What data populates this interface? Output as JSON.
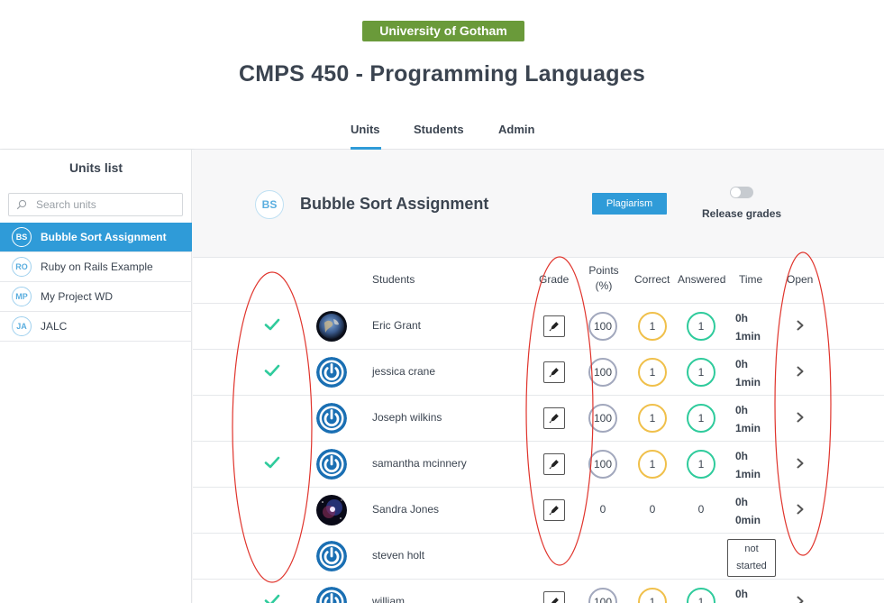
{
  "header": {
    "university": "University of Gotham",
    "course_title": "CMPS 450 - Programming Languages",
    "tabs": [
      {
        "label": "Units",
        "active": true
      },
      {
        "label": "Students",
        "active": false
      },
      {
        "label": "Admin",
        "active": false
      }
    ]
  },
  "sidebar": {
    "title": "Units list",
    "search_placeholder": "Search units",
    "units": [
      {
        "initials": "BS",
        "label": "Bubble Sort Assignment",
        "active": true
      },
      {
        "initials": "RO",
        "label": "Ruby on Rails Example",
        "active": false
      },
      {
        "initials": "MP",
        "label": "My Project WD",
        "active": false
      },
      {
        "initials": "JA",
        "label": "JALC",
        "active": false
      }
    ]
  },
  "assignment": {
    "initials": "BS",
    "title": "Bubble Sort Assignment",
    "plagiarism_label": "Plagiarism",
    "release_label": "Release grades"
  },
  "table": {
    "headers": {
      "students": "Students",
      "grade": "Grade",
      "points_1": "Points",
      "points_2": "(%)",
      "correct": "Correct",
      "answered": "Answered",
      "time": "Time",
      "open": "Open"
    },
    "rows": [
      {
        "checked": true,
        "avatar": "earth",
        "name": "Eric Grant",
        "points": "100",
        "correct": "1",
        "answered": "1",
        "time_1": "0h",
        "time_2": "1min",
        "started": true,
        "circles": true
      },
      {
        "checked": true,
        "avatar": "power",
        "name": "jessica crane",
        "points": "100",
        "correct": "1",
        "answered": "1",
        "time_1": "0h",
        "time_2": "1min",
        "started": true,
        "circles": true
      },
      {
        "checked": false,
        "avatar": "power",
        "name": "Joseph wilkins",
        "points": "100",
        "correct": "1",
        "answered": "1",
        "time_1": "0h",
        "time_2": "1min",
        "started": true,
        "circles": true
      },
      {
        "checked": true,
        "avatar": "power",
        "name": "samantha mcinnery",
        "points": "100",
        "correct": "1",
        "answered": "1",
        "time_1": "0h",
        "time_2": "1min",
        "started": true,
        "circles": true
      },
      {
        "checked": false,
        "avatar": "space",
        "name": "Sandra Jones",
        "points": "0",
        "correct": "0",
        "answered": "0",
        "time_1": "0h",
        "time_2": "0min",
        "started": true,
        "circles": false
      },
      {
        "checked": false,
        "avatar": "power",
        "name": "steven holt",
        "not_started_1": "not",
        "not_started_2": "started",
        "started": false
      },
      {
        "checked": true,
        "avatar": "power",
        "name": "william ...",
        "points": "100",
        "correct": "1",
        "answered": "1",
        "time_1": "0h",
        "time_2": "",
        "started": true,
        "circles": true
      }
    ]
  },
  "colors": {
    "accent": "#2f9bd8",
    "university": "#6a9a3a",
    "check": "#2fcb9c",
    "points_ring": "#a2a8bd",
    "correct_ring": "#f0c04b",
    "answered_ring": "#2fcb9c",
    "annotation": "#e0342c"
  }
}
